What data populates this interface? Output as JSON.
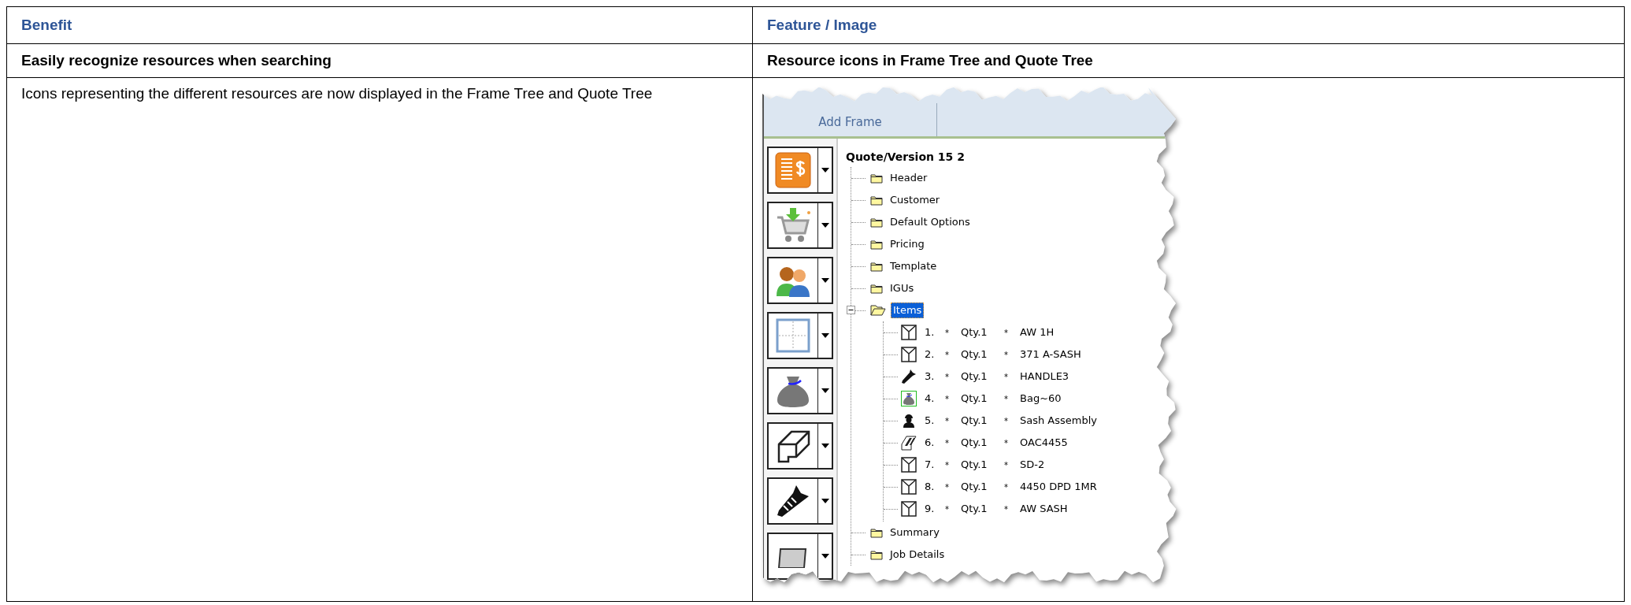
{
  "table": {
    "columns": [
      "Benefit",
      "Feature / Image"
    ],
    "rows": [
      {
        "kind": "heading",
        "cells": [
          "Easily recognize resources when searching",
          "Resource icons in Frame Tree and Quote Tree"
        ]
      },
      {
        "kind": "content",
        "text": "Icons representing the different resources are now displayed in the Frame Tree and Quote Tree",
        "image": {
          "toolbar": {
            "button": "Add Frame"
          },
          "side_buttons": [
            {
              "kind": "invoice"
            },
            {
              "kind": "cart"
            },
            {
              "kind": "people"
            },
            {
              "kind": "window"
            },
            {
              "kind": "bag"
            },
            {
              "kind": "profile"
            },
            {
              "kind": "screw"
            },
            {
              "kind": "block"
            }
          ],
          "tree": {
            "root": "Quote/Version 15 2",
            "children": [
              {
                "label": "Header",
                "selected": false
              },
              {
                "label": "Customer",
                "selected": false
              },
              {
                "label": "Default Options",
                "selected": false
              },
              {
                "label": "Pricing",
                "selected": false
              },
              {
                "label": "Template",
                "selected": false
              },
              {
                "label": "IGUs",
                "selected": false
              },
              {
                "label": "Items",
                "selected": true,
                "expanded": true,
                "children": [
                  {
                    "kind": "frame",
                    "number": "1.",
                    "separator": "*",
                    "qty": "Qty.1",
                    "name": "AW 1H",
                    "selected": false
                  },
                  {
                    "kind": "frame",
                    "number": "2.",
                    "separator": "*",
                    "qty": "Qty.1",
                    "name": "371 A-SASH",
                    "selected": false
                  },
                  {
                    "kind": "screw",
                    "number": "3.",
                    "separator": "*",
                    "qty": "Qty.1",
                    "name": "HANDLE3",
                    "selected": false
                  },
                  {
                    "kind": "bag",
                    "number": "4.",
                    "separator": "*",
                    "qty": "Qty.1",
                    "name": "Bag~60",
                    "selected": false
                  },
                  {
                    "kind": "worker",
                    "number": "5.",
                    "separator": "*",
                    "qty": "Qty.1",
                    "name": "Sash Assembly",
                    "selected": false
                  },
                  {
                    "kind": "profile",
                    "number": "6.",
                    "separator": "*",
                    "qty": "Qty.1",
                    "name": "OAC4455",
                    "selected": false
                  },
                  {
                    "kind": "frame",
                    "number": "7.",
                    "separator": "*",
                    "qty": "Qty.1",
                    "name": "SD-2",
                    "selected": false
                  },
                  {
                    "kind": "frame",
                    "number": "8.",
                    "separator": "*",
                    "qty": "Qty.1",
                    "name": "4450 DPD 1MR",
                    "selected": false
                  },
                  {
                    "kind": "frame",
                    "number": "9.",
                    "separator": "*",
                    "qty": "Qty.1",
                    "name": "AW SASH",
                    "selected": false
                  }
                ]
              },
              {
                "label": "Summary",
                "selected": false
              },
              {
                "label": "Job Details",
                "selected": false
              }
            ]
          }
        }
      }
    ]
  }
}
